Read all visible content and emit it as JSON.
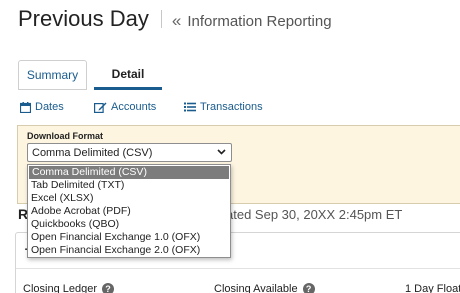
{
  "header": {
    "title": "Previous Day",
    "breadcrumb_icon": "double-chevron-left-icon",
    "breadcrumb_label": "Information Reporting"
  },
  "tabs": [
    {
      "label": "Summary",
      "active": false
    },
    {
      "label": "Detail",
      "active": true
    }
  ],
  "actions": [
    {
      "label": "Dates",
      "icon": "calendar-icon"
    },
    {
      "label": "Accounts",
      "icon": "edit-icon"
    },
    {
      "label": "Transactions",
      "icon": "list-icon"
    }
  ],
  "download": {
    "label": "Download Format",
    "selected": "Comma Delimited (CSV)",
    "options": [
      "Comma Delimited (CSV)",
      "Tab Delimited (TXT)",
      "Excel (XLSX)",
      "Adobe Acrobat (PDF)",
      "Quickbooks (QBO)",
      "Open Financial Exchange 1.0 (OFX)",
      "Open Financial Exchange 2.0 (OFX)"
    ]
  },
  "section": {
    "heading_fragment": "R",
    "updated_fragment": "ated Sep 30, 20XX 2:45pm ET",
    "card_fragment": "T"
  },
  "metrics": [
    {
      "label": "Closing Ledger"
    },
    {
      "label": "Closing Available"
    },
    {
      "label": "1 Day Float"
    }
  ],
  "colors": {
    "link": "#1a5c8e",
    "panel_bg": "#fdf5e0",
    "selected_option_bg": "#7c7c7c"
  }
}
